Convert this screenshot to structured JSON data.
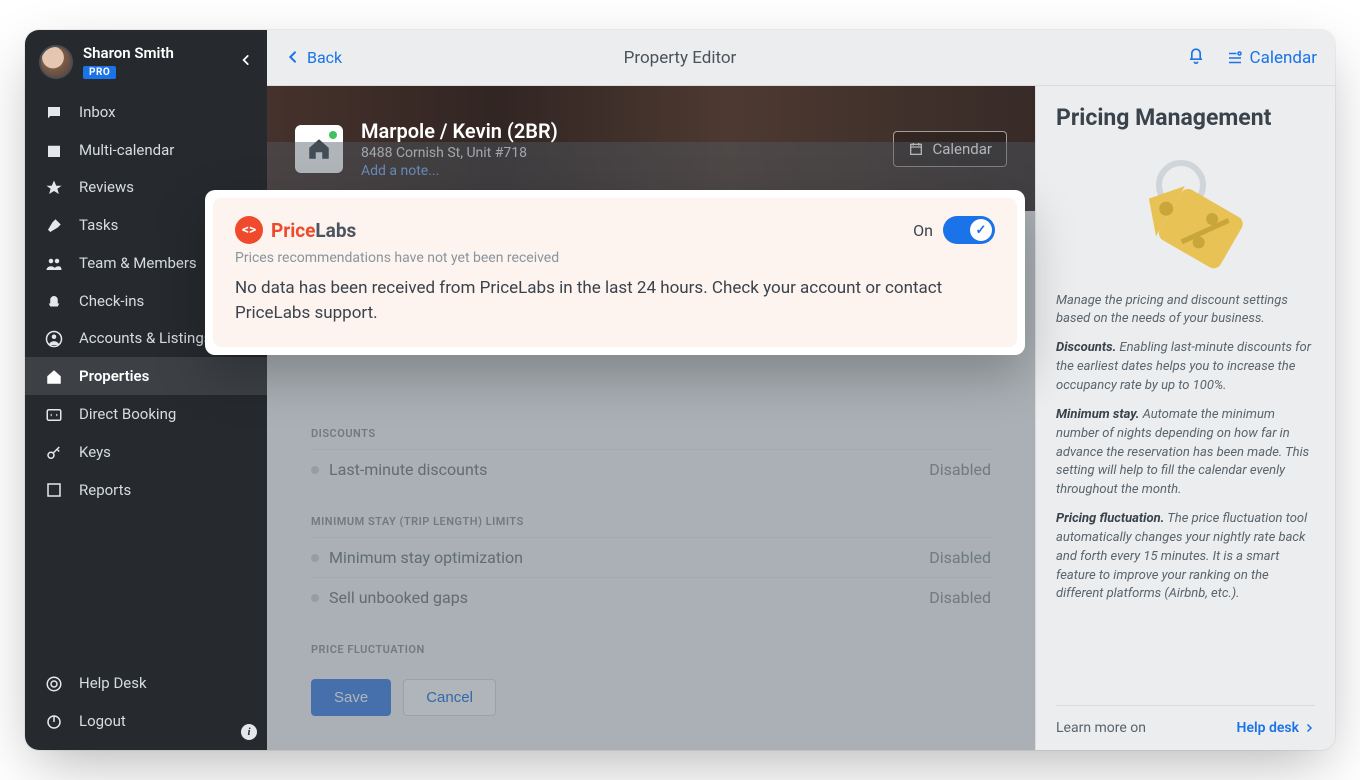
{
  "user": {
    "name": "Sharon Smith",
    "badge": "PRO"
  },
  "sidebar": {
    "items": [
      {
        "label": "Inbox"
      },
      {
        "label": "Multi-calendar"
      },
      {
        "label": "Reviews"
      },
      {
        "label": "Tasks"
      },
      {
        "label": "Team & Members"
      },
      {
        "label": "Check-ins"
      },
      {
        "label": "Accounts & Listings"
      },
      {
        "label": "Properties"
      },
      {
        "label": "Direct Booking"
      },
      {
        "label": "Keys"
      },
      {
        "label": "Reports"
      }
    ],
    "bottom": [
      {
        "label": "Help Desk"
      },
      {
        "label": "Logout"
      }
    ]
  },
  "topbar": {
    "back": "Back",
    "title": "Property Editor",
    "calendar": "Calendar"
  },
  "property": {
    "title": "Marpole / Kevin (2BR)",
    "address": "8488 Cornish St, Unit #718",
    "add_note": "Add a note...",
    "calendar_btn": "Calendar"
  },
  "settings": {
    "sections": [
      {
        "heading": "DISCOUNTS",
        "rows": [
          {
            "label": "Last-minute discounts",
            "status": "Disabled"
          }
        ]
      },
      {
        "heading": "MINIMUM STAY (TRIP LENGTH) LIMITS",
        "rows": [
          {
            "label": "Minimum stay optimization",
            "status": "Disabled"
          },
          {
            "label": "Sell unbooked gaps",
            "status": "Disabled"
          }
        ]
      },
      {
        "heading": "PRICE FLUCTUATION",
        "rows": []
      }
    ],
    "save": "Save",
    "cancel": "Cancel"
  },
  "modal": {
    "brand_p1": "Price",
    "brand_p2": "Labs",
    "toggle_label": "On",
    "subhead": "Prices recommendations have not yet been received",
    "message": "No data has been received from PriceLabs in the last 24 hours. Check your account or contact PriceLabs support."
  },
  "help": {
    "title": "Pricing Management",
    "intro": "Manage the pricing and discount settings based on the needs of your business.",
    "p1_b": "Discounts.",
    "p1": " Enabling last-minute discounts for the earliest dates helps you to increase the occupancy rate by up to 100%.",
    "p2_b": "Minimum stay.",
    "p2": " Automate the minimum number of nights depending on how far in advance the reservation has been made. This setting will help to fill the calendar evenly throughout the month.",
    "p3_b": "Pricing fluctuation.",
    "p3": " The price fluctuation tool automatically changes your nightly rate back and forth every 15 minutes. It is a smart feature to improve your ranking on the different platforms (Airbnb, etc.).",
    "footer_label": "Learn more on",
    "footer_link": "Help desk"
  }
}
